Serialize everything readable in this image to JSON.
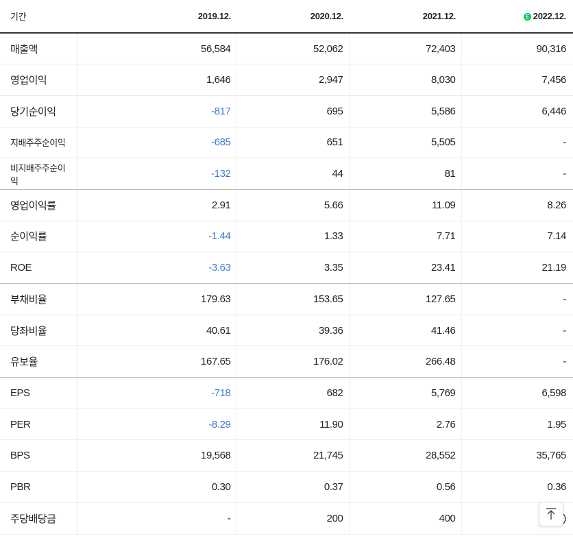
{
  "header": {
    "period_label": "기간",
    "estimate_badge": "E",
    "columns": [
      "2019.12.",
      "2020.12.",
      "2021.12.",
      "2022.12."
    ]
  },
  "rows": [
    {
      "label": "매출액",
      "values": [
        "56,584",
        "52,062",
        "72,403",
        "90,316"
      ]
    },
    {
      "label": "영업이익",
      "values": [
        "1,646",
        "2,947",
        "8,030",
        "7,456"
      ]
    },
    {
      "label": "당기순이익",
      "values": [
        "-817",
        "695",
        "5,586",
        "6,446"
      ]
    },
    {
      "label": "지배주주순이익",
      "values": [
        "-685",
        "651",
        "5,505",
        "-"
      ]
    },
    {
      "label": "비지배주주순이익",
      "values": [
        "-132",
        "44",
        "81",
        "-"
      ]
    },
    {
      "label": "영업이익률",
      "values": [
        "2.91",
        "5.66",
        "11.09",
        "8.26"
      ]
    },
    {
      "label": "순이익률",
      "values": [
        "-1.44",
        "1.33",
        "7.71",
        "7.14"
      ]
    },
    {
      "label": "ROE",
      "values": [
        "-3.63",
        "3.35",
        "23.41",
        "21.19"
      ]
    },
    {
      "label": "부채비율",
      "values": [
        "179.63",
        "153.65",
        "127.65",
        "-"
      ]
    },
    {
      "label": "당좌비율",
      "values": [
        "40.61",
        "39.36",
        "41.46",
        "-"
      ]
    },
    {
      "label": "유보율",
      "values": [
        "167.65",
        "176.02",
        "266.48",
        "-"
      ]
    },
    {
      "label": "EPS",
      "values": [
        "-718",
        "682",
        "5,769",
        "6,598"
      ]
    },
    {
      "label": "PER",
      "values": [
        "-8.29",
        "11.90",
        "2.76",
        "1.95"
      ]
    },
    {
      "label": "BPS",
      "values": [
        "19,568",
        "21,745",
        "28,552",
        "35,765"
      ]
    },
    {
      "label": "PBR",
      "values": [
        "0.30",
        "0.37",
        "0.56",
        "0.36"
      ]
    },
    {
      "label": "주당배당금",
      "values": [
        "-",
        "200",
        "400",
        ")"
      ]
    }
  ],
  "top_button_icon": "arrow-up-to-top-icon",
  "colors": {
    "negative": "#3a7bd5",
    "estimate_badge": "#03c75a"
  }
}
